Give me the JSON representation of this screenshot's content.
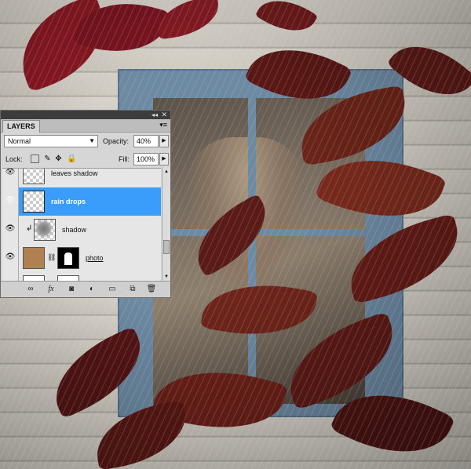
{
  "panel": {
    "tab_label": "LAYERS",
    "menu_icon": "panel-menu-icon",
    "collapse_icon": "double-arrow-icon",
    "close_icon": "close-icon",
    "blend_mode": "Normal",
    "opacity_label": "Opacity:",
    "opacity_value": "40%",
    "lock_label": "Lock:",
    "fill_label": "Fill:",
    "fill_value": "100%"
  },
  "layers": [
    {
      "name": "leaves shadow",
      "visible": true,
      "selected": false
    },
    {
      "name": "rain drops",
      "visible": true,
      "selected": true
    },
    {
      "name": "shadow",
      "visible": true,
      "selected": false,
      "clipped": true
    },
    {
      "name": "photo",
      "visible": true,
      "selected": false,
      "has_mask": true
    }
  ],
  "footer_icons": [
    "link-icon",
    "fx-icon",
    "mask-icon",
    "adjustment-icon",
    "folder-icon",
    "new-layer-icon",
    "trash-icon"
  ],
  "colors": {
    "selection": "#3b9dfb",
    "panel_bg": "#d6d6d6",
    "leaf": "#7a1a1c"
  }
}
